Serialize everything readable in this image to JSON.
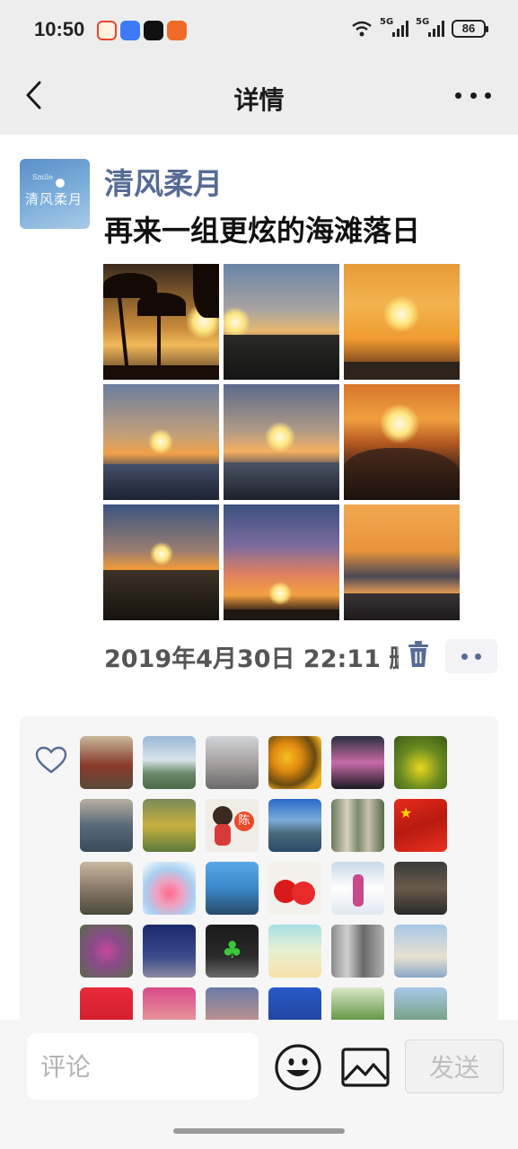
{
  "status_bar": {
    "time": "10:50",
    "battery": "86",
    "network_labels": [
      "5G",
      "5G"
    ],
    "icons": [
      "app-red-icon",
      "messages-icon",
      "tiktok-icon",
      "app-orange-icon",
      "wifi-icon",
      "signal-icon",
      "signal-icon",
      "battery-icon"
    ]
  },
  "header": {
    "title": "详情",
    "back_icon": "chevron-left-icon",
    "more_icon": "more-dots-icon"
  },
  "post": {
    "author": "清风柔月",
    "avatar_text": "清风柔月",
    "avatar_small_text": "Smile",
    "text": "再来一组更炫的海滩落日",
    "photos_count_grid": "3x3",
    "time": "2019年4月30日 22:11 删除",
    "delete_icon": "trash-icon",
    "more_icon": "more-dots-icon"
  },
  "likes": {
    "icon": "heart-outline-icon",
    "avatars_visible": 30,
    "avatar_badge_text": "陈"
  },
  "bottom_bar": {
    "comment_placeholder": "评论",
    "emoji_icon": "emoji-icon",
    "image_icon": "image-icon",
    "send_label": "发送"
  },
  "colors": {
    "author_link": "#576b95",
    "bar_bg": "#ededed",
    "likes_bg": "#f6f6f6"
  }
}
